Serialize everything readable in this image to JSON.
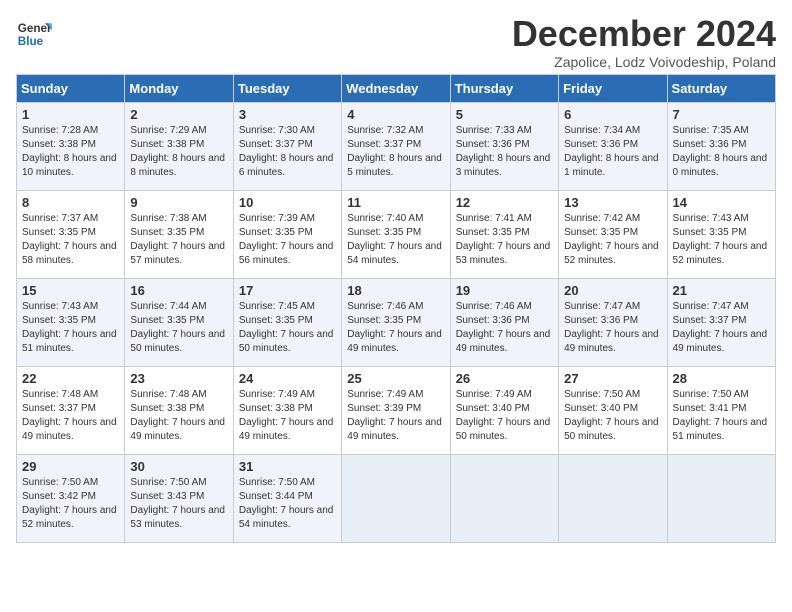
{
  "header": {
    "logo_line1": "General",
    "logo_line2": "Blue",
    "month_title": "December 2024",
    "subtitle": "Zapolice, Lodz Voivodeship, Poland"
  },
  "days_of_week": [
    "Sunday",
    "Monday",
    "Tuesday",
    "Wednesday",
    "Thursday",
    "Friday",
    "Saturday"
  ],
  "weeks": [
    [
      {
        "day": "1",
        "sunrise": "Sunrise: 7:28 AM",
        "sunset": "Sunset: 3:38 PM",
        "daylight": "Daylight: 8 hours and 10 minutes."
      },
      {
        "day": "2",
        "sunrise": "Sunrise: 7:29 AM",
        "sunset": "Sunset: 3:38 PM",
        "daylight": "Daylight: 8 hours and 8 minutes."
      },
      {
        "day": "3",
        "sunrise": "Sunrise: 7:30 AM",
        "sunset": "Sunset: 3:37 PM",
        "daylight": "Daylight: 8 hours and 6 minutes."
      },
      {
        "day": "4",
        "sunrise": "Sunrise: 7:32 AM",
        "sunset": "Sunset: 3:37 PM",
        "daylight": "Daylight: 8 hours and 5 minutes."
      },
      {
        "day": "5",
        "sunrise": "Sunrise: 7:33 AM",
        "sunset": "Sunset: 3:36 PM",
        "daylight": "Daylight: 8 hours and 3 minutes."
      },
      {
        "day": "6",
        "sunrise": "Sunrise: 7:34 AM",
        "sunset": "Sunset: 3:36 PM",
        "daylight": "Daylight: 8 hours and 1 minute."
      },
      {
        "day": "7",
        "sunrise": "Sunrise: 7:35 AM",
        "sunset": "Sunset: 3:36 PM",
        "daylight": "Daylight: 8 hours and 0 minutes."
      }
    ],
    [
      {
        "day": "8",
        "sunrise": "Sunrise: 7:37 AM",
        "sunset": "Sunset: 3:35 PM",
        "daylight": "Daylight: 7 hours and 58 minutes."
      },
      {
        "day": "9",
        "sunrise": "Sunrise: 7:38 AM",
        "sunset": "Sunset: 3:35 PM",
        "daylight": "Daylight: 7 hours and 57 minutes."
      },
      {
        "day": "10",
        "sunrise": "Sunrise: 7:39 AM",
        "sunset": "Sunset: 3:35 PM",
        "daylight": "Daylight: 7 hours and 56 minutes."
      },
      {
        "day": "11",
        "sunrise": "Sunrise: 7:40 AM",
        "sunset": "Sunset: 3:35 PM",
        "daylight": "Daylight: 7 hours and 54 minutes."
      },
      {
        "day": "12",
        "sunrise": "Sunrise: 7:41 AM",
        "sunset": "Sunset: 3:35 PM",
        "daylight": "Daylight: 7 hours and 53 minutes."
      },
      {
        "day": "13",
        "sunrise": "Sunrise: 7:42 AM",
        "sunset": "Sunset: 3:35 PM",
        "daylight": "Daylight: 7 hours and 52 minutes."
      },
      {
        "day": "14",
        "sunrise": "Sunrise: 7:43 AM",
        "sunset": "Sunset: 3:35 PM",
        "daylight": "Daylight: 7 hours and 52 minutes."
      }
    ],
    [
      {
        "day": "15",
        "sunrise": "Sunrise: 7:43 AM",
        "sunset": "Sunset: 3:35 PM",
        "daylight": "Daylight: 7 hours and 51 minutes."
      },
      {
        "day": "16",
        "sunrise": "Sunrise: 7:44 AM",
        "sunset": "Sunset: 3:35 PM",
        "daylight": "Daylight: 7 hours and 50 minutes."
      },
      {
        "day": "17",
        "sunrise": "Sunrise: 7:45 AM",
        "sunset": "Sunset: 3:35 PM",
        "daylight": "Daylight: 7 hours and 50 minutes."
      },
      {
        "day": "18",
        "sunrise": "Sunrise: 7:46 AM",
        "sunset": "Sunset: 3:35 PM",
        "daylight": "Daylight: 7 hours and 49 minutes."
      },
      {
        "day": "19",
        "sunrise": "Sunrise: 7:46 AM",
        "sunset": "Sunset: 3:36 PM",
        "daylight": "Daylight: 7 hours and 49 minutes."
      },
      {
        "day": "20",
        "sunrise": "Sunrise: 7:47 AM",
        "sunset": "Sunset: 3:36 PM",
        "daylight": "Daylight: 7 hours and 49 minutes."
      },
      {
        "day": "21",
        "sunrise": "Sunrise: 7:47 AM",
        "sunset": "Sunset: 3:37 PM",
        "daylight": "Daylight: 7 hours and 49 minutes."
      }
    ],
    [
      {
        "day": "22",
        "sunrise": "Sunrise: 7:48 AM",
        "sunset": "Sunset: 3:37 PM",
        "daylight": "Daylight: 7 hours and 49 minutes."
      },
      {
        "day": "23",
        "sunrise": "Sunrise: 7:48 AM",
        "sunset": "Sunset: 3:38 PM",
        "daylight": "Daylight: 7 hours and 49 minutes."
      },
      {
        "day": "24",
        "sunrise": "Sunrise: 7:49 AM",
        "sunset": "Sunset: 3:38 PM",
        "daylight": "Daylight: 7 hours and 49 minutes."
      },
      {
        "day": "25",
        "sunrise": "Sunrise: 7:49 AM",
        "sunset": "Sunset: 3:39 PM",
        "daylight": "Daylight: 7 hours and 49 minutes."
      },
      {
        "day": "26",
        "sunrise": "Sunrise: 7:49 AM",
        "sunset": "Sunset: 3:40 PM",
        "daylight": "Daylight: 7 hours and 50 minutes."
      },
      {
        "day": "27",
        "sunrise": "Sunrise: 7:50 AM",
        "sunset": "Sunset: 3:40 PM",
        "daylight": "Daylight: 7 hours and 50 minutes."
      },
      {
        "day": "28",
        "sunrise": "Sunrise: 7:50 AM",
        "sunset": "Sunset: 3:41 PM",
        "daylight": "Daylight: 7 hours and 51 minutes."
      }
    ],
    [
      {
        "day": "29",
        "sunrise": "Sunrise: 7:50 AM",
        "sunset": "Sunset: 3:42 PM",
        "daylight": "Daylight: 7 hours and 52 minutes."
      },
      {
        "day": "30",
        "sunrise": "Sunrise: 7:50 AM",
        "sunset": "Sunset: 3:43 PM",
        "daylight": "Daylight: 7 hours and 53 minutes."
      },
      {
        "day": "31",
        "sunrise": "Sunrise: 7:50 AM",
        "sunset": "Sunset: 3:44 PM",
        "daylight": "Daylight: 7 hours and 54 minutes."
      },
      null,
      null,
      null,
      null
    ]
  ]
}
